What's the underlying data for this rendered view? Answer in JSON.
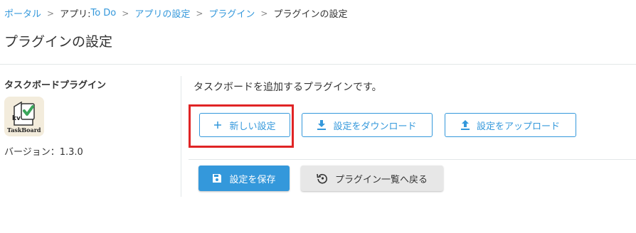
{
  "breadcrumb": {
    "portal": "ポータル",
    "app_prefix": "アプリ: ",
    "app_name": "To Do",
    "app_settings": "アプリの設定",
    "plugins": "プラグイン",
    "current": "プラグインの設定",
    "separator": ">"
  },
  "page_title": "プラグインの設定",
  "plugin": {
    "name": "タスクボードプラグイン",
    "icon": "taskboard-icon",
    "icon_text": "kv",
    "icon_subtext": "TaskBoard",
    "version": "バージョン：1.3.0"
  },
  "main": {
    "description": "タスクボードを追加するプラグインです。",
    "new_setting_label": "新しい設定",
    "download_label": "設定をダウンロード",
    "upload_label": "設定をアップロード",
    "save_label": "設定を保存",
    "back_label": "プラグイン一覧へ戻る"
  },
  "colors": {
    "accent": "#3498db",
    "highlight": "#e02425",
    "icon_green": "#3aa55a"
  }
}
